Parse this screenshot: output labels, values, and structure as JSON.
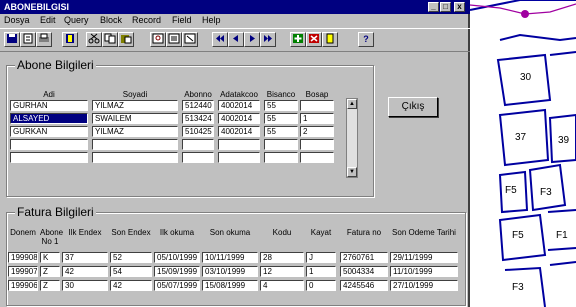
{
  "window": {
    "title": "ABONEBILGISI",
    "min_glyph": "_",
    "max_glyph": "□",
    "close_glyph": "x"
  },
  "menu": [
    "Dosya",
    "Edit",
    "Query",
    "Block",
    "Record",
    "Field",
    "Help"
  ],
  "toolbar": {
    "icons": [
      "save-icon",
      "exit-icon",
      "print-icon",
      "help-book-icon",
      "cut-icon",
      "copy-icon",
      "paste-icon",
      "query-icon",
      "execute-icon",
      "cancel-icon",
      "first-record-icon",
      "prev-record-icon",
      "next-record-icon",
      "last-record-icon",
      "insert-record-icon",
      "delete-record-icon",
      "lock-icon",
      "help-icon"
    ],
    "help_label": "?"
  },
  "abone": {
    "caption": "Abone Bilgileri",
    "headers": [
      "Adi",
      "Soyadi",
      "Abonno",
      "Adatakcoo",
      "Bisanco",
      "Bosap"
    ],
    "rows": [
      [
        "GURHAN",
        "YILMAZ",
        "512440",
        "4002014",
        "55",
        ""
      ],
      [
        "ALSAYED",
        "SWAILEM",
        "513424",
        "4002014",
        "55",
        "1"
      ],
      [
        "GURKAN",
        "YILMAZ",
        "510425",
        "4002014",
        "55",
        "2"
      ],
      [
        "",
        "",
        "",
        "",
        "",
        ""
      ],
      [
        "",
        "",
        "",
        "",
        "",
        ""
      ]
    ]
  },
  "cikis_label": "Çıkış",
  "fatura": {
    "caption": "Fatura Bilgileri",
    "headers": [
      "Donem",
      "Abone No 1",
      "Ilk Endex",
      "Son Endex",
      "Ilk okuma",
      "Son okuma",
      "Kodu",
      "Kayat",
      "Fatura no",
      "Son Odeme Tarihi"
    ],
    "rows": [
      [
        "199908",
        "K",
        "37",
        "52",
        "05/10/1999",
        "10/11/1999",
        "28",
        "J",
        "2760761",
        "29/11/1999"
      ],
      [
        "199907",
        "Z",
        "42",
        "54",
        "15/09/1999",
        "03/10/1999",
        "12",
        "1",
        "5004334",
        "11/10/1999"
      ],
      [
        "199906",
        "Z",
        "30",
        "42",
        "05/07/1999",
        "15/08/1999",
        "4",
        "0",
        "4245546",
        "27/10/1999"
      ]
    ]
  },
  "map": {
    "parcels": [
      "30",
      "37",
      "39",
      "F5",
      "F3",
      "F5",
      "F1",
      "F3"
    ],
    "route_color": "#a000a0",
    "line_color": "#0000a0"
  }
}
